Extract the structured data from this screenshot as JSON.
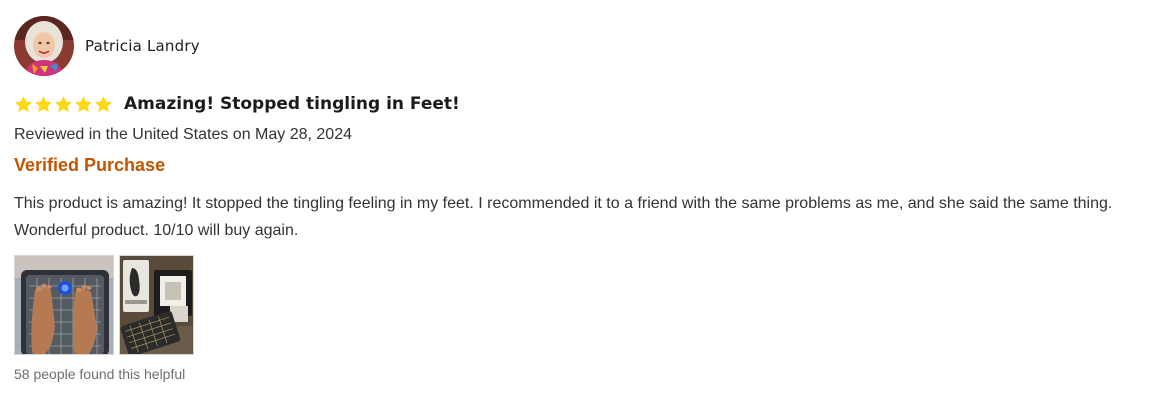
{
  "review": {
    "reviewer_name": "Patricia Landry",
    "avatar_icon": "reviewer-avatar-photo",
    "rating": 5,
    "rating_max": 5,
    "star_color": "#ffd814",
    "title": "Amazing! Stopped tingling in Feet!",
    "meta": "Reviewed in the United States on May 28, 2024",
    "verified_label": "Verified Purchase",
    "verified_color": "#c45500",
    "body": "This product is amazing! It stopped the tingling feeling in my feet. I recommended it to a friend with the same problems as me, and she said the same thing. Wonderful product. 10/10 will buy again.",
    "images": [
      {
        "icon": "feet-on-massager-photo"
      },
      {
        "icon": "product-box-photo"
      }
    ],
    "helpful_text": "58 people found this helpful"
  }
}
